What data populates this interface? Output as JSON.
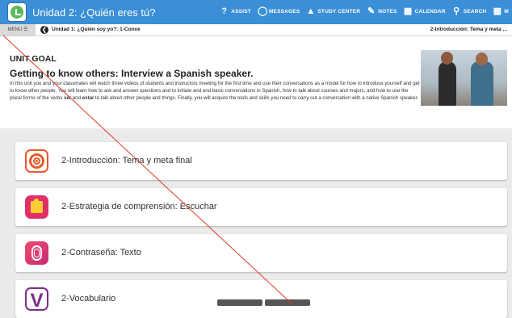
{
  "header": {
    "title": "Unidad 2: ¿Quién eres tú?",
    "nav": [
      {
        "icon": "question-circle-icon",
        "glyph": "?",
        "label": "ASSIST"
      },
      {
        "icon": "speech-bubble-icon",
        "glyph": "◯",
        "label": "MESSAGES"
      },
      {
        "icon": "graduation-cap-icon",
        "glyph": "▲",
        "label": "STUDY CENTER"
      },
      {
        "icon": "edit-note-icon",
        "glyph": "✎",
        "label": "NOTES"
      },
      {
        "icon": "calendar-icon",
        "glyph": "▦",
        "label": "CALENDAR"
      },
      {
        "icon": "search-icon",
        "glyph": "⚲",
        "label": "SEARCH"
      },
      {
        "icon": "grid-menu-icon",
        "glyph": "▦",
        "label": "M"
      }
    ]
  },
  "subbar": {
    "menu_label": "MENU ☰",
    "breadcrumb": "Unidad 1: ¿Quién soy yo?: 1-Conve",
    "current_section": "2-Introducción: Tema y meta ..."
  },
  "goal": {
    "label": "UNIT GOAL",
    "heading": "Getting to know others: Interview a Spanish speaker.",
    "text_part1": "In this unit you and your classmates will watch three videos of students and instructors meeting for the first time and use their conversations as a model for how to introduce yourself and get to know other people. You will learn how to ask and answer questions and to initiate and end basic conversations in Spanish, how to talk about courses and majors, and how to use the plural forms of the verbs ",
    "verb1": "ser",
    "text_part2": " and ",
    "verb2": "estar",
    "text_part3": " to talk about other people and things. Finally, you will acquire the tools and skills you need to carry out a conversation with a native Spanish speaker."
  },
  "items": [
    {
      "label": "2-Introducción: Tema y meta final",
      "icon": "target-icon"
    },
    {
      "label": "2-Estrategia de comprensión: Escuchar",
      "icon": "puzzle-icon"
    },
    {
      "label": "2-Contraseña: Texto",
      "icon": "fingerprint-icon"
    },
    {
      "label": "2-Vocabulario",
      "icon": "vocabulary-v-icon",
      "glyph": "V"
    }
  ],
  "colors": {
    "topbar": "#3a8fd6",
    "background": "#ebebeb"
  }
}
